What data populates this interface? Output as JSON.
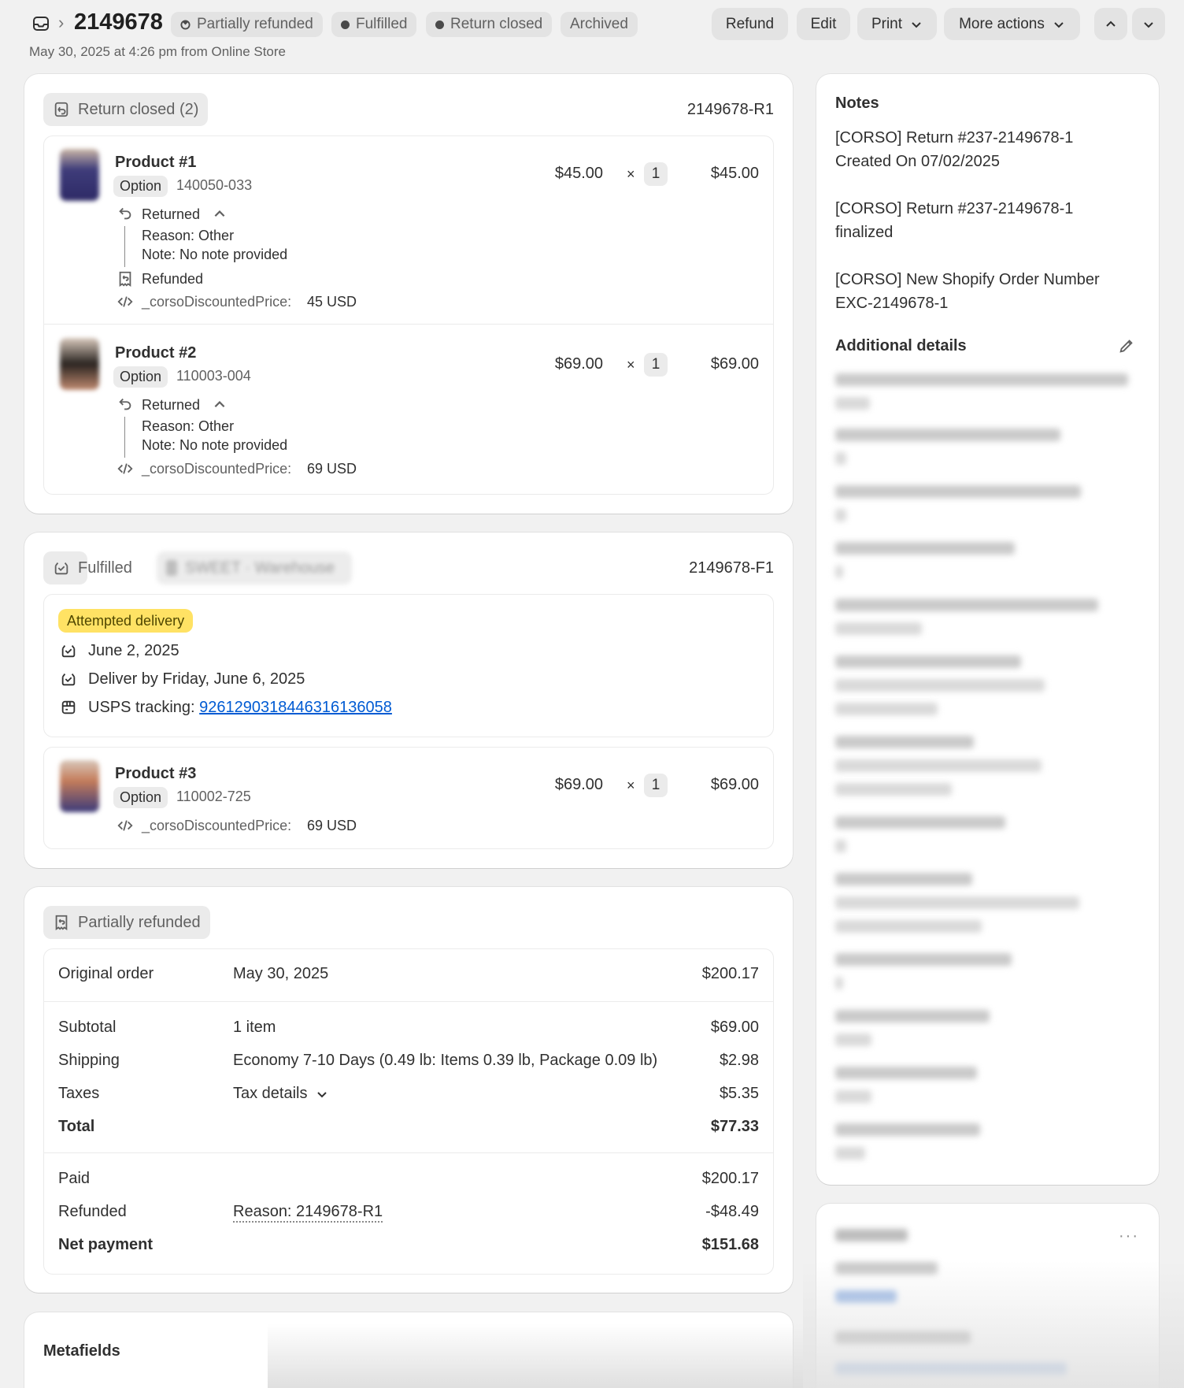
{
  "header": {
    "order_number": "2149678",
    "badges": [
      "Partially refunded",
      "Fulfilled",
      "Return closed",
      "Archived"
    ],
    "subline": "May 30, 2025 at 4:26 pm from Online Store",
    "buttons": {
      "refund": "Refund",
      "edit": "Edit",
      "print": "Print",
      "more_actions": "More actions"
    }
  },
  "return_card": {
    "status": "Return closed (2)",
    "reference": "2149678-R1",
    "items": [
      {
        "name": "Product #1",
        "option_label": "Option",
        "sku": "140050-033",
        "price": "$45.00",
        "times": "×",
        "qty": "1",
        "total": "$45.00",
        "returned_label": "Returned",
        "reason": "Reason: Other",
        "note": "Note: No note provided",
        "refunded_label": "Refunded",
        "attr_key": "_corsoDiscountedPrice:",
        "attr_value": "45 USD"
      },
      {
        "name": "Product #2",
        "option_label": "Option",
        "sku": "110003-004",
        "price": "$69.00",
        "times": "×",
        "qty": "1",
        "total": "$69.00",
        "returned_label": "Returned",
        "reason": "Reason: Other",
        "note": "Note: No note provided",
        "attr_key": "_corsoDiscountedPrice:",
        "attr_value": "69 USD"
      }
    ]
  },
  "fulfilled_card": {
    "status": "Fulfilled",
    "location_redacted": "SWEET · Warehouse",
    "reference": "2149678-F1",
    "delivery_badge": "Attempted delivery",
    "date": "June 2, 2025",
    "deliver_by": "Deliver by Friday, June 6, 2025",
    "tracking_label": "USPS tracking:",
    "tracking_number": "9261290318446316136058",
    "item": {
      "name": "Product #3",
      "option_label": "Option",
      "sku": "110002-725",
      "price": "$69.00",
      "times": "×",
      "qty": "1",
      "total": "$69.00",
      "attr_key": "_corsoDiscountedPrice:",
      "attr_value": "69 USD"
    }
  },
  "payment_card": {
    "status": "Partially refunded",
    "original": {
      "label": "Original order",
      "desc": "May 30, 2025",
      "amount": "$200.17"
    },
    "subtotal": {
      "label": "Subtotal",
      "desc": "1 item",
      "amount": "$69.00"
    },
    "shipping": {
      "label": "Shipping",
      "desc": "Economy 7-10 Days (0.49 lb: Items 0.39 lb, Package 0.09 lb)",
      "amount": "$2.98"
    },
    "taxes": {
      "label": "Taxes",
      "desc": "Tax details",
      "amount": "$5.35"
    },
    "total": {
      "label": "Total",
      "amount": "$77.33"
    },
    "paid": {
      "label": "Paid",
      "amount": "$200.17"
    },
    "refunded": {
      "label": "Refunded",
      "desc": "Reason: 2149678-R1",
      "amount": "-$48.49"
    },
    "net": {
      "label": "Net payment",
      "amount": "$151.68"
    }
  },
  "metafields": {
    "title": "Metafields"
  },
  "notes": {
    "title": "Notes",
    "entries": [
      "[CORSO] Return #237-2149678-1 Created On 07/02/2025",
      "[CORSO] Return #237-2149678-1 finalized",
      "[CORSO] New Shopify Order Number EXC-2149678-1"
    ],
    "additional_title": "Additional details"
  },
  "colors": {
    "page_bg": "#f1f1f1",
    "badge_bg": "#e3e3e3",
    "attempted_bg": "#ffe264",
    "link": "#005bd3"
  }
}
